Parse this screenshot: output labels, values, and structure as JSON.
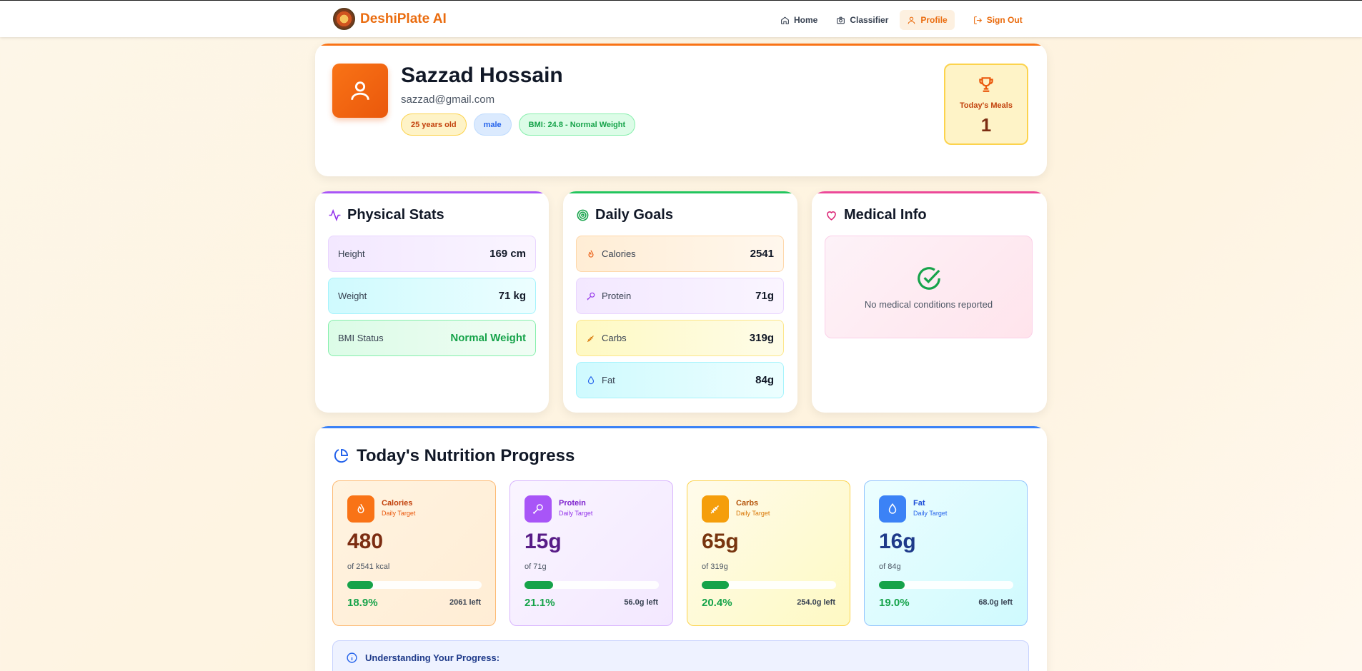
{
  "nav": {
    "brand": "DeshiPlate AI",
    "items": [
      {
        "label": "Home",
        "icon": "home-icon"
      },
      {
        "label": "Classifier",
        "icon": "camera-icon"
      },
      {
        "label": "Profile",
        "icon": "user-icon",
        "active": true
      },
      {
        "label": "Sign Out",
        "icon": "logout-icon"
      }
    ]
  },
  "profile": {
    "name": "Sazzad Hossain",
    "email": "sazzad@gmail.com",
    "badges": {
      "age": "25 years old",
      "gender": "male",
      "bmi": "BMI: 24.8 - Normal Weight"
    },
    "meals_label": "Today's Meals",
    "meals_value": "1"
  },
  "physical": {
    "title": "Physical Stats",
    "rows": [
      {
        "label": "Height",
        "value": "169 cm"
      },
      {
        "label": "Weight",
        "value": "71 kg"
      },
      {
        "label": "BMI Status",
        "value": "Normal Weight"
      }
    ]
  },
  "goals": {
    "title": "Daily Goals",
    "rows": [
      {
        "label": "Calories",
        "value": "2541"
      },
      {
        "label": "Protein",
        "value": "71g"
      },
      {
        "label": "Carbs",
        "value": "319g"
      },
      {
        "label": "Fat",
        "value": "84g"
      }
    ]
  },
  "medical": {
    "title": "Medical Info",
    "message": "No medical conditions reported"
  },
  "nutrition": {
    "title": "Today's Nutrition Progress",
    "tiles": [
      {
        "name": "Calories",
        "sub": "Daily Target",
        "value": "480",
        "of": "of 2541 kcal",
        "pct": "18.9%",
        "progress": 0.189,
        "left": "2061 left"
      },
      {
        "name": "Protein",
        "sub": "Daily Target",
        "value": "15g",
        "of": "of 71g",
        "pct": "21.1%",
        "progress": 0.211,
        "left": "56.0g left"
      },
      {
        "name": "Carbs",
        "sub": "Daily Target",
        "value": "65g",
        "of": "of 319g",
        "pct": "20.4%",
        "progress": 0.204,
        "left": "254.0g left"
      },
      {
        "name": "Fat",
        "sub": "Daily Target",
        "value": "16g",
        "of": "of 84g",
        "pct": "19.0%",
        "progress": 0.19,
        "left": "68.0g left"
      }
    ],
    "understanding": "Understanding Your Progress:"
  },
  "colors": {
    "brand": "#ea6c0f",
    "success": "#16a34a"
  }
}
